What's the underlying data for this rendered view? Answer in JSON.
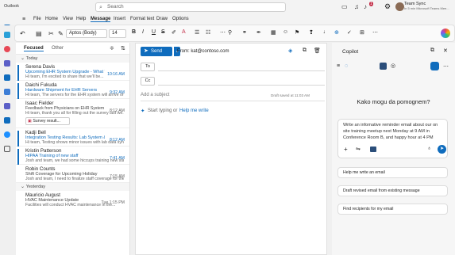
{
  "app": {
    "title": "Outlook"
  },
  "search": {
    "placeholder": "Search"
  },
  "titlebar": {
    "badge_count": "1"
  },
  "sync": {
    "title": "Team Sync",
    "subtitle": "In 5 min Microsoft Teams Mee..."
  },
  "menu": {
    "items": [
      "File",
      "Home",
      "View",
      "Help",
      "Message",
      "Insert",
      "Format text",
      "Draw",
      "Options"
    ],
    "active": "Message"
  },
  "ribbon": {
    "font": "Aptos (Body)",
    "size": "14"
  },
  "mail_list": {
    "tabs": [
      "Focused",
      "Other"
    ],
    "groups": {
      "today": "Today",
      "yesterday": "Yesterday"
    },
    "items": [
      {
        "from": "Serena Davis",
        "subject": "Upcoming EHR System Upgrade - What Y...",
        "preview": "Hi team, I'm excited to share that we'll be...",
        "time": "10:16 AM"
      },
      {
        "from": "Daichi Fukuda",
        "subject": "Hardware Shipment for EHR Servers",
        "preview": "Hi team, The servers for the EHR system will arrive on W...",
        "time": "9:32 AM"
      },
      {
        "from": "Isaac Fielder",
        "subject": "",
        "preview": "Feedback from Physicians on EHR System",
        "preview2": "Hi team, thank you all for filling out the survey last we...",
        "time": "8:12 AM",
        "attachment": "Survey result..."
      },
      {
        "from": "Kadji Bell",
        "subject": "Integration Testing Results: Lab System & EH...",
        "preview": "Hi team, Testing shows minor issues with lab data syncin...",
        "time": "8:12 AM"
      },
      {
        "from": "Kristin Patterson",
        "subject": "HIPAA Training of new staff",
        "preview": "Josh and team, we had some hiccups training new staff o...",
        "time": "7:41 AM"
      },
      {
        "from": "Robin Counts",
        "subject": "Shift Coverage for Upcoming Holiday",
        "preview": "Josh and team, I need to finalize staff coverage for the ...",
        "time": "7:15 AM"
      }
    ],
    "yesterday_items": [
      {
        "from": "Mauricio August",
        "subject": "HVAC Maintenance Update",
        "preview": "Facilities will conduct HVAC maintenance in the...",
        "time": "Tue 1:15 PM"
      }
    ]
  },
  "compose": {
    "send_label": "Send",
    "from_label": "From: kat@contoso.com",
    "to_label": "To",
    "cc_label": "Cc",
    "subject_placeholder": "Add a subject",
    "draft_status": "Draft saved at 11:03 AM",
    "body_placeholder": "Start typing or",
    "help_link": "Help me write"
  },
  "copilot": {
    "title": "Copilot",
    "greeting": "Kako mogu da pomognem?",
    "prompt_text": "Write an infomative reminder email about our on site training meetup next Monday at 9 AM in Conference Room B, and happy hour at 4 PM",
    "suggestions": [
      "Help me write an email",
      "Draft revised email from existing message",
      "Find recipients for my email"
    ]
  },
  "colors": {
    "accent": "#0f6cbd"
  }
}
